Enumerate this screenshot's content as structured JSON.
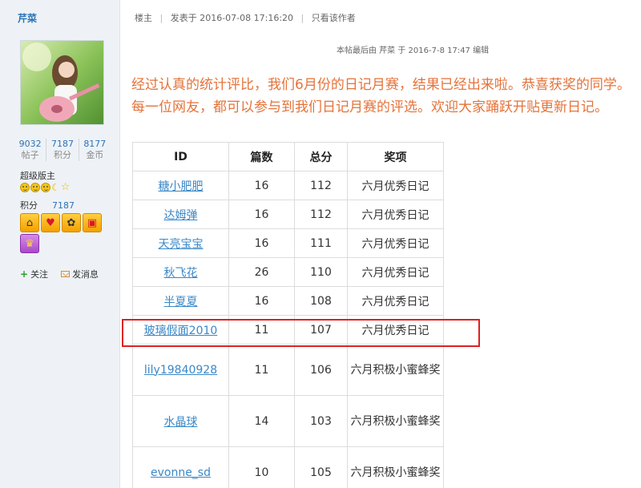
{
  "user": {
    "name": "芹菜",
    "stats": [
      {
        "num": "9032",
        "label": "帖子"
      },
      {
        "num": "7187",
        "label": "积分"
      },
      {
        "num": "8177",
        "label": "金币"
      }
    ],
    "role": "超级版主",
    "points_label": "积分",
    "points_value": "7187",
    "follow_label": "关注",
    "message_label": "发消息"
  },
  "post": {
    "floor": "楼主",
    "posted": "发表于 2016-07-08 17:16:20",
    "only_author": "只看该作者",
    "edit_note": "本帖最后由 芹菜 于 2016-7-8 17:47 编辑",
    "announcement": "经过认真的统计评比，我们6月份的日记月赛，结果已经出来啦。恭喜获奖的同学。每一位网友，都可以参与到我们日记月赛的评选。欢迎大家踊跃开贴更新日记。"
  },
  "table": {
    "headers": [
      "ID",
      "篇数",
      "总分",
      "奖项"
    ],
    "rows": [
      {
        "id": "糖小肥肥",
        "count": "16",
        "score": "112",
        "award": "六月优秀日记"
      },
      {
        "id": "达姆弹",
        "count": "16",
        "score": "112",
        "award": "六月优秀日记"
      },
      {
        "id": "天亮宝宝",
        "count": "16",
        "score": "111",
        "award": "六月优秀日记"
      },
      {
        "id": "秋飞花",
        "count": "26",
        "score": "110",
        "award": "六月优秀日记"
      },
      {
        "id": "半夏夏",
        "count": "16",
        "score": "108",
        "award": "六月优秀日记"
      },
      {
        "id": "玻璃假面2010",
        "count": "11",
        "score": "107",
        "award": "六月优秀日记"
      },
      {
        "id": "lily19840928",
        "count": "11",
        "score": "106",
        "award": "六月积极小蜜蜂奖"
      },
      {
        "id": "水晶球",
        "count": "14",
        "score": "103",
        "award": "六月积极小蜜蜂奖"
      },
      {
        "id": "evonne_sd",
        "count": "10",
        "score": "105",
        "award": "六月积极小蜜蜂奖"
      }
    ]
  },
  "colors": {
    "accent_orange": "#e5733a",
    "link_blue": "#3a88c8",
    "highlight_red": "#e02020"
  }
}
